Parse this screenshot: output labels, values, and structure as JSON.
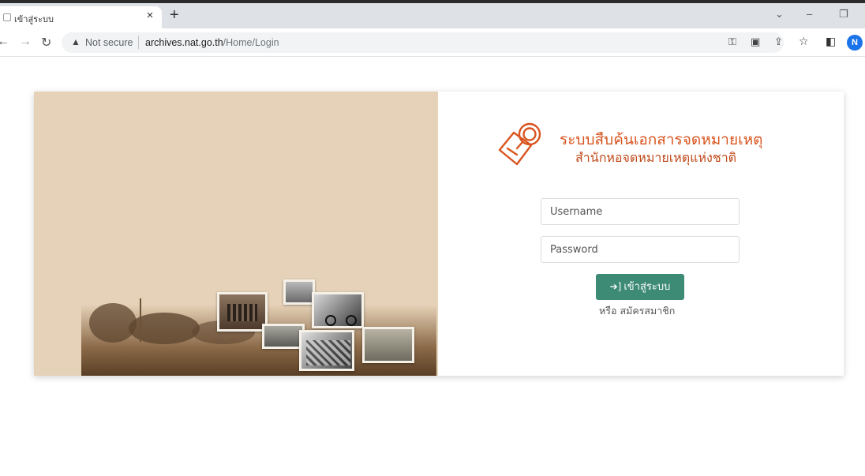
{
  "browser": {
    "tab_title": "เข้าสู่ระบบ",
    "tab_close": "×",
    "new_tab": "+",
    "win_menu": "⌄",
    "win_minimize": "–",
    "win_restore": "❐",
    "security_label": "Not secure",
    "url_host": "archives.nat.go.th",
    "url_path": "/Home/Login",
    "profile_initial": "N"
  },
  "header": {
    "title_line1": "ระบบสืบค้นเอกสารจดหมายเหตุ",
    "title_line2": "สำนักหอจดหมายเหตุแห่งชาติ"
  },
  "form": {
    "username_placeholder": "Username",
    "password_placeholder": "Password",
    "login_label": "เข้าสู่ระบบ",
    "or_label": "หรือ",
    "register_label": "สมัครสมาชิก"
  },
  "colors": {
    "brand_orange": "#d9541e",
    "button_green": "#3d8a75",
    "hero_background": "#e6d2b8"
  }
}
